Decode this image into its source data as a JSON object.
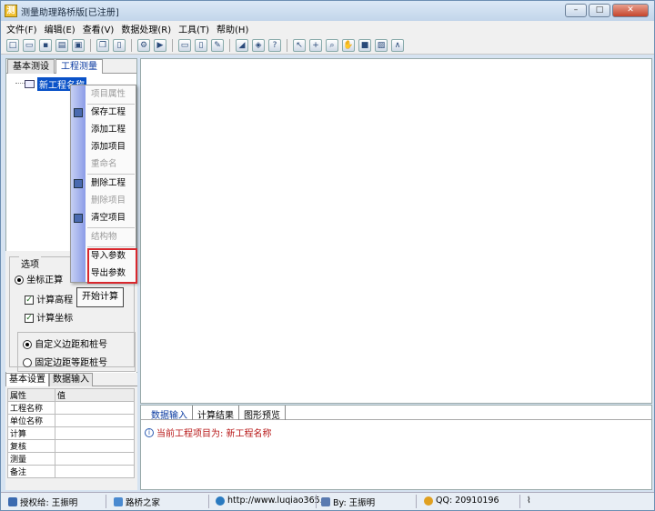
{
  "window": {
    "title": "测量助理路桥版[已注册]",
    "app_icon_char": "测"
  },
  "menu": [
    "文件(F)",
    "编辑(E)",
    "查看(V)",
    "数据处理(R)",
    "工具(T)",
    "帮助(H)"
  ],
  "left_tabs": [
    "基本测设",
    "工程测量"
  ],
  "tree": {
    "root_label": "新工程名称"
  },
  "context_menu": [
    {
      "label": "项目属性",
      "disabled": true
    },
    {
      "label": "保存工程",
      "disabled": false,
      "icon": "save-icon"
    },
    {
      "label": "添加工程",
      "disabled": false
    },
    {
      "label": "添加项目",
      "disabled": false
    },
    {
      "label": "重命名",
      "disabled": true
    },
    {
      "label": "删除工程",
      "disabled": false,
      "icon": "delete-icon"
    },
    {
      "label": "删除项目",
      "disabled": true
    },
    {
      "label": "清空项目",
      "disabled": false,
      "icon": "clear-icon"
    },
    {
      "label": "结构物",
      "disabled": true
    },
    {
      "label": "导入参数",
      "disabled": false
    },
    {
      "label": "导出参数",
      "disabled": false
    }
  ],
  "options": {
    "group_label": "选项",
    "coord_forward": "坐标正算",
    "calc_elevation": "计算高程",
    "calc_coords": "计算坐标",
    "custom_offset": "自定义边距和桩号",
    "fixed_offset": "固定边距等距桩号",
    "start_button": "开始计算"
  },
  "prop_tabs": [
    "基本设置",
    "数据输入"
  ],
  "prop_table": {
    "headers": [
      "属性",
      "值"
    ],
    "rows": [
      "工程名称",
      "单位名称",
      "计算",
      "复核",
      "测量",
      "备注"
    ]
  },
  "bottom_tabs": [
    "数据输入",
    "计算结果",
    "图形预览"
  ],
  "output_message": "当前工程项目为: 新工程名称",
  "status": {
    "licensee": "授权给: 王振明",
    "site": "路桥之家",
    "url": "http://www.luqiao365.",
    "author": "By: 王振明",
    "qq": "QQ: 20910196"
  },
  "colors": {
    "highlight_border": "#d8282e",
    "output_text": "#b81818",
    "selection": "#0a52c8"
  }
}
